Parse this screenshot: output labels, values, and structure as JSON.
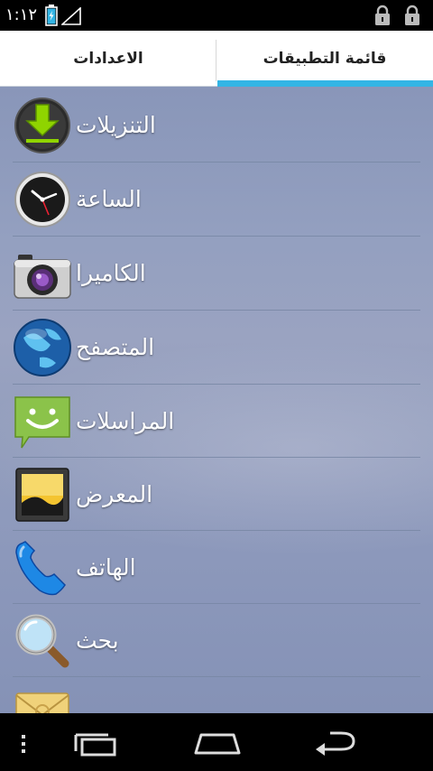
{
  "status_bar": {
    "time": "١:١٢",
    "icons": [
      "battery-icon",
      "signal-icon",
      "lock-icon",
      "lock-icon"
    ]
  },
  "tabs": [
    {
      "label": "الاعدادات",
      "selected": false
    },
    {
      "label": "قائمة التطبيقات",
      "selected": true
    }
  ],
  "apps": [
    {
      "label": "التنزيلات",
      "icon": "download-icon"
    },
    {
      "label": "الساعة",
      "icon": "clock-icon"
    },
    {
      "label": "الكاميرا",
      "icon": "camera-icon"
    },
    {
      "label": "المتصفح",
      "icon": "globe-icon"
    },
    {
      "label": "المراسلات",
      "icon": "messaging-icon"
    },
    {
      "label": "المعرض",
      "icon": "gallery-icon"
    },
    {
      "label": "الهاتف",
      "icon": "phone-icon"
    },
    {
      "label": "بحث",
      "icon": "search-icon"
    },
    {
      "label": "",
      "icon": "email-icon"
    }
  ],
  "nav_bar": {
    "buttons": [
      "menu-icon",
      "recent-apps-icon",
      "home-icon",
      "back-icon"
    ]
  },
  "colors": {
    "accent": "#33b5e5",
    "list_background": "#939ebd",
    "status_bar": "#000000"
  }
}
